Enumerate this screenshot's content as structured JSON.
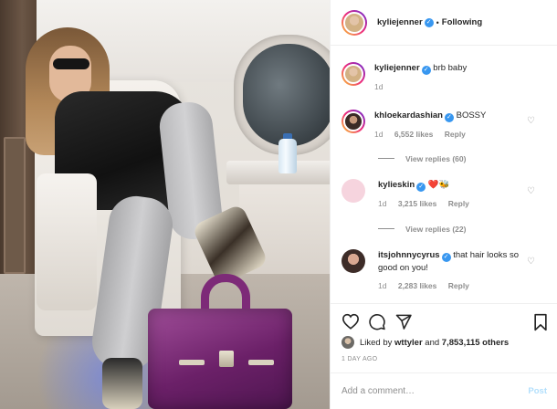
{
  "post": {
    "author": "kyliejenner",
    "follow_state": "Following",
    "separator": "•",
    "caption": "brb baby",
    "caption_age": "1d"
  },
  "comments": [
    {
      "user": "khloekardashian",
      "verified": true,
      "text": "BOSSY",
      "age": "1d",
      "likes": "6,552 likes",
      "reply": "Reply",
      "view_replies": "View replies (60)"
    },
    {
      "user": "kylieskin",
      "verified": true,
      "text": "❤️🐝",
      "age": "1d",
      "likes": "3,215 likes",
      "reply": "Reply",
      "view_replies": "View replies (22)"
    },
    {
      "user": "itsjohnnycyrus",
      "verified": true,
      "text": "that hair looks so good on you!",
      "age": "1d",
      "likes": "2,283 likes",
      "reply": "Reply"
    }
  ],
  "actions": {
    "like_icon": "heart-icon",
    "comment_icon": "comment-icon",
    "share_icon": "share-icon",
    "save_icon": "bookmark-icon"
  },
  "likes": {
    "prefix": "Liked by",
    "user": "wttyler",
    "connector": "and",
    "count": "7,853,115 others"
  },
  "timestamp": "1 DAY AGO",
  "add_comment": {
    "placeholder": "Add a comment…",
    "post_label": "Post"
  },
  "colors": {
    "verified": "#3897f0",
    "muted": "#8e8e8e",
    "post_button_disabled": "#b2dffc",
    "bag": "#6b2068"
  }
}
